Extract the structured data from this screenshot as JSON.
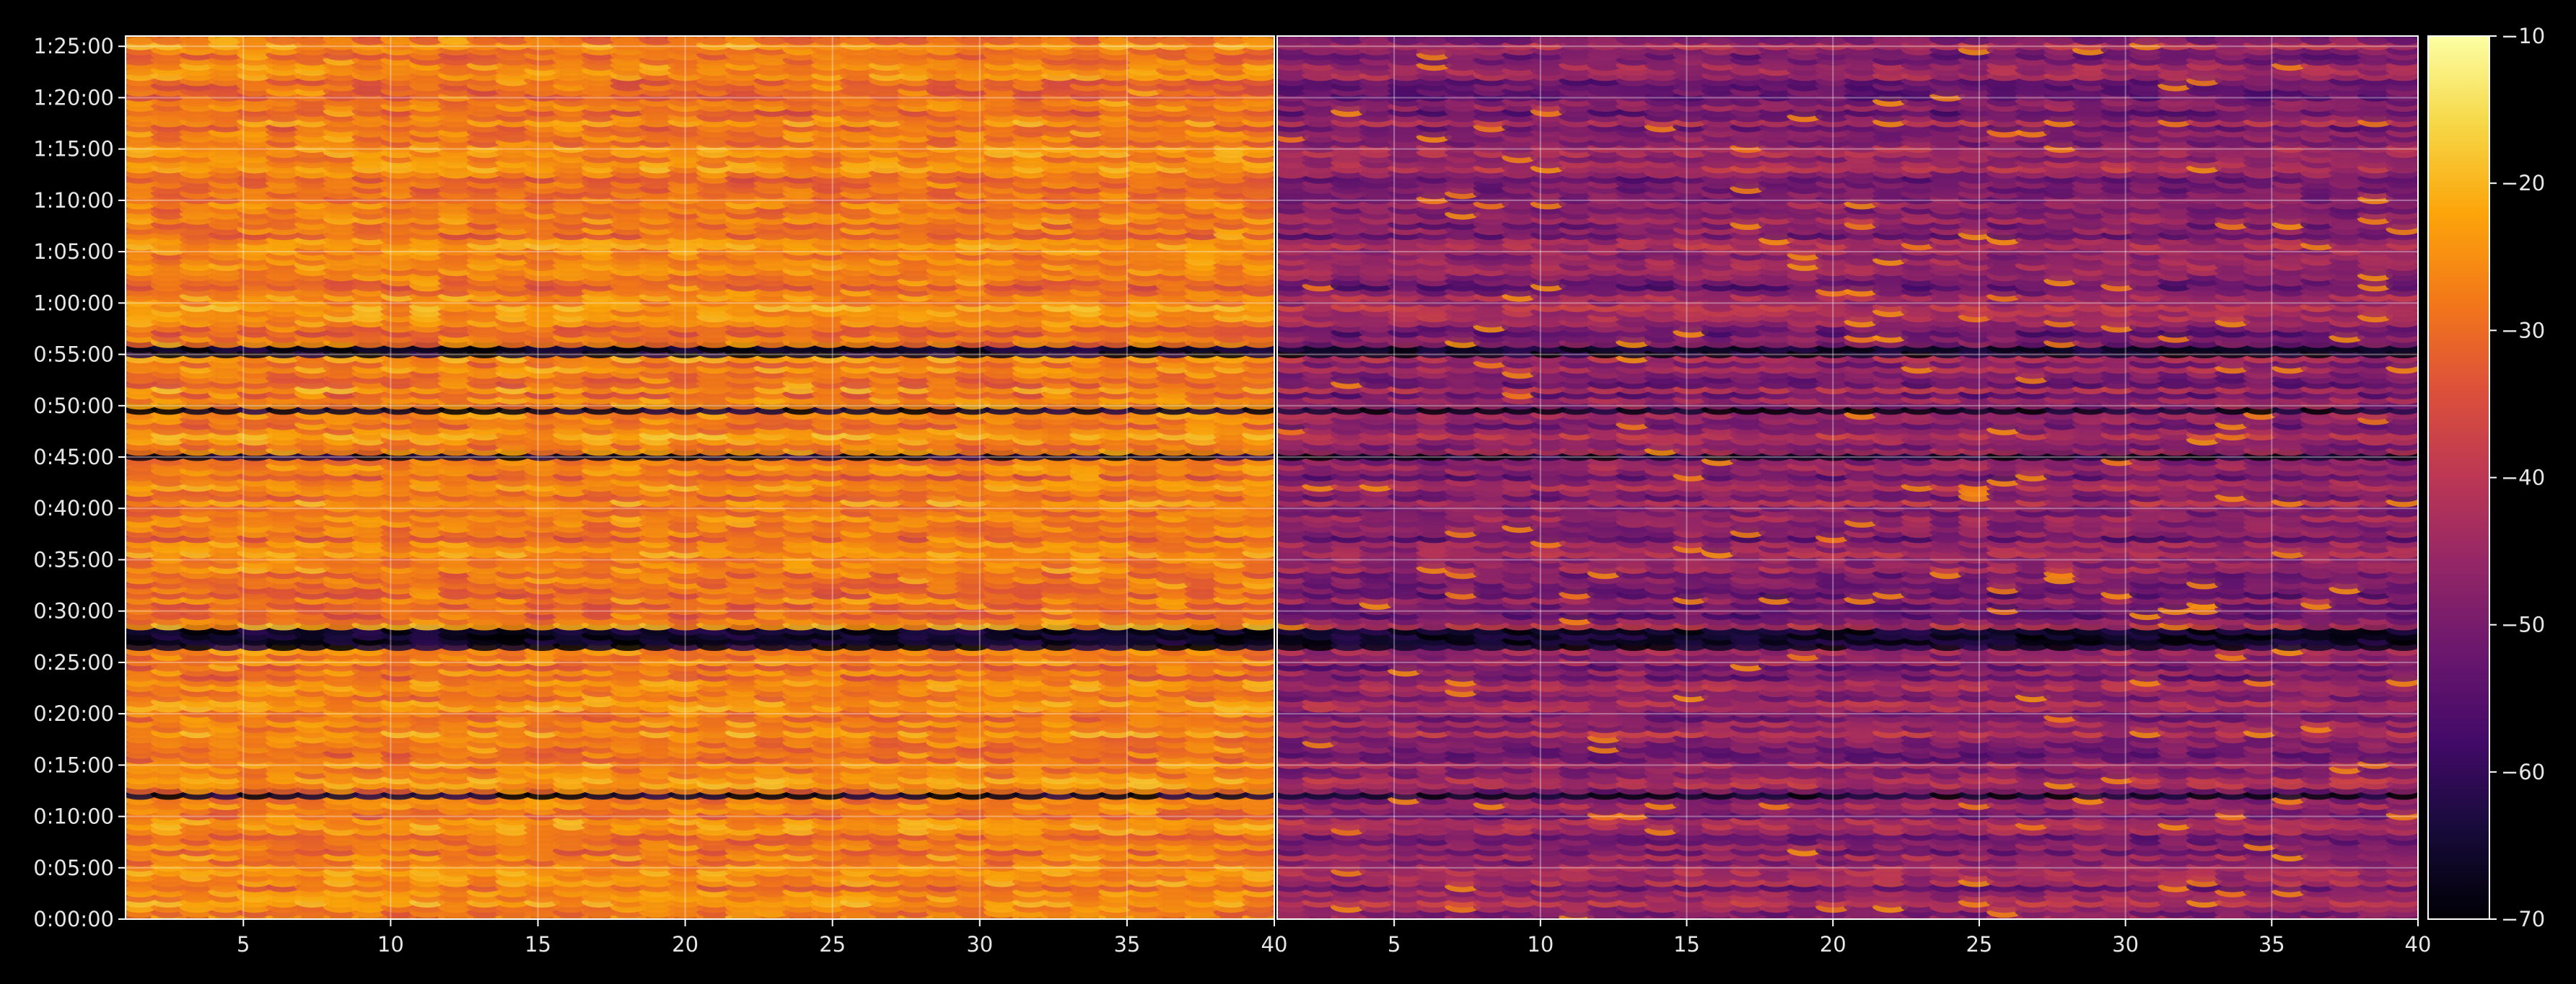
{
  "chart_data": {
    "type": "heatmap",
    "title": "",
    "xlabel": "",
    "ylabel": "",
    "panels": [
      {
        "name": "",
        "xlim": [
          1,
          40
        ],
        "x_tick_labels": [
          "5",
          "10",
          "15",
          "20",
          "25",
          "30",
          "35",
          "40"
        ],
        "x_tick_values": [
          5,
          10,
          15,
          20,
          25,
          30,
          35,
          40
        ],
        "typical_value_range": [
          -38,
          -22
        ],
        "peak_value": -20
      },
      {
        "name": "",
        "xlim": [
          1,
          40
        ],
        "x_tick_labels": [
          "5",
          "10",
          "15",
          "20",
          "25",
          "30",
          "35",
          "40"
        ],
        "x_tick_values": [
          5,
          10,
          15,
          20,
          25,
          30,
          35,
          40
        ],
        "typical_value_range": [
          -62,
          -40
        ],
        "peak_value": -24
      }
    ],
    "y_axis": {
      "ylim": [
        0,
        86
      ],
      "unit": "minutes (h:mm:ss)",
      "tick_values": [
        0,
        5,
        10,
        15,
        20,
        25,
        30,
        35,
        40,
        45,
        50,
        55,
        60,
        65,
        70,
        75,
        80,
        85
      ],
      "tick_labels": [
        "0:00:00",
        "0:05:00",
        "0:10:00",
        "0:15:00",
        "0:20:00",
        "0:25:00",
        "0:30:00",
        "0:35:00",
        "0:40:00",
        "0:45:00",
        "0:50:00",
        "0:55:00",
        "1:00:00",
        "1:05:00",
        "1:10:00",
        "1:15:00",
        "1:20:00",
        "1:25:00"
      ]
    },
    "colorbar": {
      "colormap": "inferno",
      "range": [
        -70,
        -10
      ],
      "tick_values": [
        -70,
        -60,
        -50,
        -40,
        -30,
        -20,
        -10
      ],
      "tick_labels": [
        "−70",
        "−60",
        "−50",
        "−40",
        "−30",
        "−20",
        "−10"
      ]
    },
    "dark_band_minutes": [
      {
        "start": 26.5,
        "end": 28.5
      },
      {
        "start": 44.8,
        "end": 45.4
      },
      {
        "start": 11.8,
        "end": 12.6
      },
      {
        "start": 49.5,
        "end": 50.2
      },
      {
        "start": 55.0,
        "end": 56.0
      }
    ],
    "grid": true,
    "legend": "none"
  },
  "colors": {
    "background": "#000000",
    "grid": "#ffffff",
    "text": "#e6e6e6"
  }
}
